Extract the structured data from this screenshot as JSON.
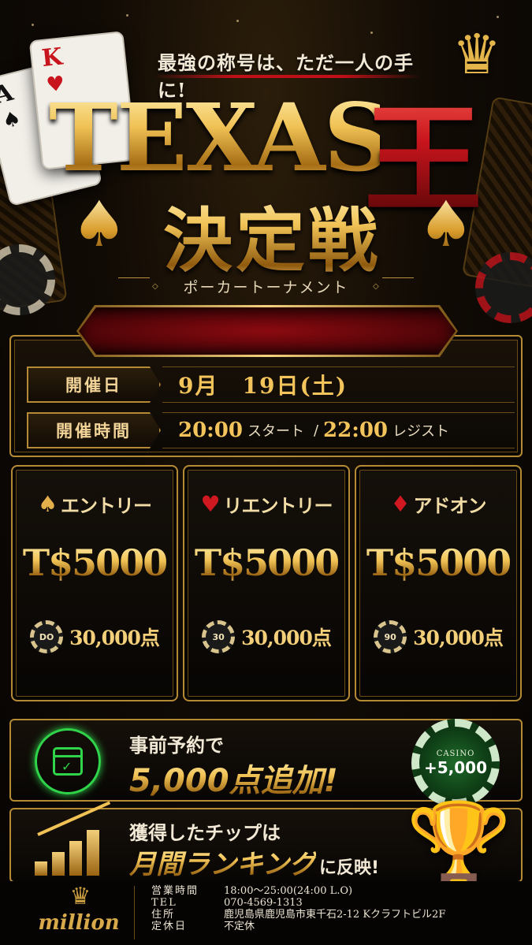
{
  "header": {
    "tagline": "最強の称号は、ただ一人の手に!",
    "title_texas": "TEXAS",
    "title_king": "王",
    "title_sub": "決定戦",
    "subtitle": "ポーカートーナメント",
    "cards": [
      {
        "rank": "A",
        "suit": "♠"
      },
      {
        "rank": "K",
        "suit": "♥"
      }
    ]
  },
  "schedule": {
    "date_label": "開催日",
    "date_value": "9月　19日(土)",
    "time_label": "開催時間",
    "start_time": "20:00",
    "start_text": "スタート",
    "separator": "/",
    "register_time": "22:00",
    "register_text": "レジスト"
  },
  "prices": [
    {
      "suit": "♠",
      "suit_color": "#e4b04c",
      "label": "エントリー",
      "price": "T$5000",
      "chip": "DO",
      "points": "30,000点"
    },
    {
      "suit": "♥",
      "suit_color": "#d01820",
      "label": "リエントリー",
      "price": "T$5000",
      "chip": "30",
      "points": "30,000点"
    },
    {
      "suit": "♦",
      "suit_color": "#d01820",
      "label": "アドオン",
      "price": "T$5000",
      "chip": "90",
      "points": "30,000点"
    }
  ],
  "reservation": {
    "line1": "事前予約で",
    "line2": "5,000点追加!",
    "chip_brand": "CASINO",
    "chip_bonus": "+5,000"
  },
  "ranking": {
    "line1": "獲得したチップは",
    "line2_strong": "月間ランキング",
    "line2_rest": "に反映!"
  },
  "footer": {
    "logo": "million",
    "info": [
      {
        "key": "営業時間",
        "value": "18:00〜25:00(24:00 L.O)"
      },
      {
        "key": "TEL",
        "value": "070-4569-1313"
      },
      {
        "key": "住所",
        "value": "鹿児島県鹿児島市東千石2-12 Kクラフトビル2F"
      },
      {
        "key": "定休日",
        "value": "不定休"
      }
    ]
  },
  "colors": {
    "gold": "#f0c255",
    "red": "#c8141c",
    "green": "#2fd44a",
    "background": "#0a0704"
  }
}
